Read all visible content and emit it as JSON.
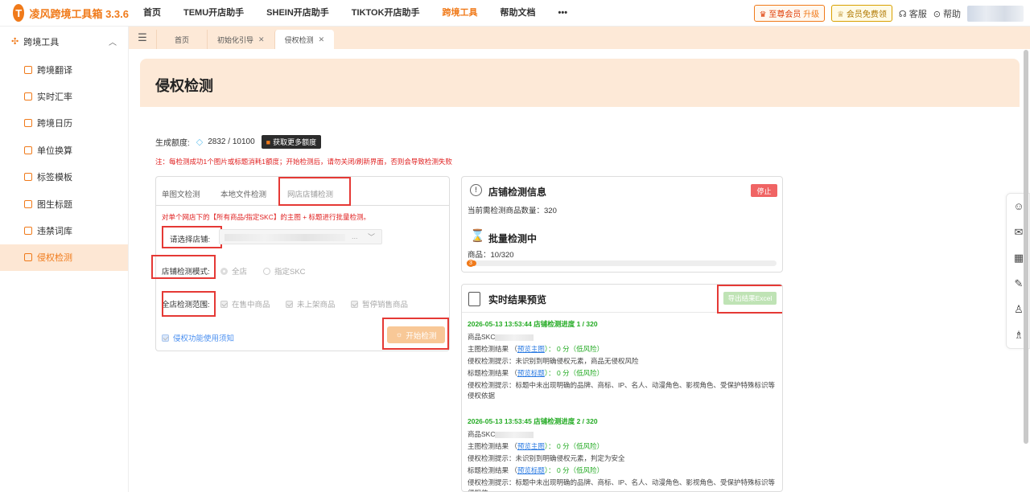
{
  "app": {
    "name": "凌风跨境工具箱 3.3.6",
    "logo_letter": "T"
  },
  "nav": {
    "items": [
      "首页",
      "TEMU开店助手",
      "SHEIN开店助手",
      "TIKTOK开店助手",
      "跨境工具",
      "帮助文档",
      "•••"
    ],
    "active": "跨境工具"
  },
  "topright": {
    "upgrade_label": "至尊会员",
    "upgrade_action": "升级",
    "member_label": "会员免费领",
    "service": "客服",
    "help": "帮助"
  },
  "sidebar": {
    "group": "跨境工具",
    "items": [
      {
        "label": "跨境翻译"
      },
      {
        "label": "实时汇率"
      },
      {
        "label": "跨境日历"
      },
      {
        "label": "单位换算"
      },
      {
        "label": "标签模板"
      },
      {
        "label": "图生标题"
      },
      {
        "label": "违禁词库"
      },
      {
        "label": "侵权检测"
      }
    ],
    "active": "侵权检测"
  },
  "tabs": [
    {
      "label": "首页",
      "closable": false
    },
    {
      "label": "初始化引导",
      "closable": true
    },
    {
      "label": "侵权检测",
      "closable": true
    }
  ],
  "page": {
    "title": "侵权检测",
    "quota_label": "生成额度:",
    "quota_value": "2832 / 10100",
    "quota_button": "获取更多额度",
    "notice": "注：每检测成功1个图片或标题消耗1额度；开始检测后，请勿关闭/刷新界面，否则会导致检测失败"
  },
  "left_panel": {
    "subtabs": [
      "单图文检测",
      "本地文件检测",
      "网店店铺检测"
    ],
    "active_subtab": "网店店铺检测",
    "description": "对单个网店下的【所有商品/指定SKC】的主图 + 标题进行批量检测。",
    "shop_label": "请选择店铺:",
    "shop_value_suffix": "...",
    "mode_label": "店铺检测模式:",
    "mode_options": [
      "全店",
      "指定SKC"
    ],
    "range_label": "全店检测范围:",
    "range_options": [
      "在售中商品",
      "未上架商品",
      "暂停销售商品"
    ],
    "agree_label": "侵权功能使用须知",
    "start_button": "开始检测"
  },
  "shop_info": {
    "title": "店铺检测信息",
    "stop_button": "停止",
    "count_line": "当前需检测商品数量：320",
    "batch_title": "批量检测中",
    "progress_line": "商品：10/320",
    "progress_fraction": 0.03125,
    "progress_badge": "3"
  },
  "results": {
    "title": "实时结果预览",
    "export_button": "导出结果Excel",
    "records": [
      {
        "time": "2026-05-13 13:53:44  店铺检测进度  1 / 320",
        "skc_label": "商品SKC",
        "main_label": "主图检测结果  （",
        "main_link": "预览主图",
        "main_score": "）：  0 分（低风险）",
        "main_hint": "侵权检测提示：未识别到明确侵权元素，商品无侵权风险",
        "title_label": "标题检测结果  （",
        "title_link": "预览标题",
        "title_score": "）：  0 分（低风险）",
        "title_hint": "侵权检测提示：标题中未出现明确的品牌、商标、IP、名人、动漫角色、影视角色、受保护特殊标识等侵权依据"
      },
      {
        "time": "2026-05-13 13:53:45  店铺检测进度  2 / 320",
        "skc_label": "商品SKC",
        "main_label": "主图检测结果  （",
        "main_link": "预览主图",
        "main_score": "）：  0 分（低风险）",
        "main_hint": "侵权检测提示：未识别到明确侵权元素，判定为安全",
        "title_label": "标题检测结果  （",
        "title_link": "预览标题",
        "title_score": "）：  0 分（低风险）",
        "title_hint": "侵权检测提示：标题中未出现明确的品牌、商标、IP、名人、动漫角色、影视角色、受保护特殊标识等侵权依"
      }
    ]
  },
  "colors": {
    "accent": "#f07a1a",
    "danger": "#e53935",
    "success": "#22aa22",
    "link": "#2a7ae2"
  }
}
